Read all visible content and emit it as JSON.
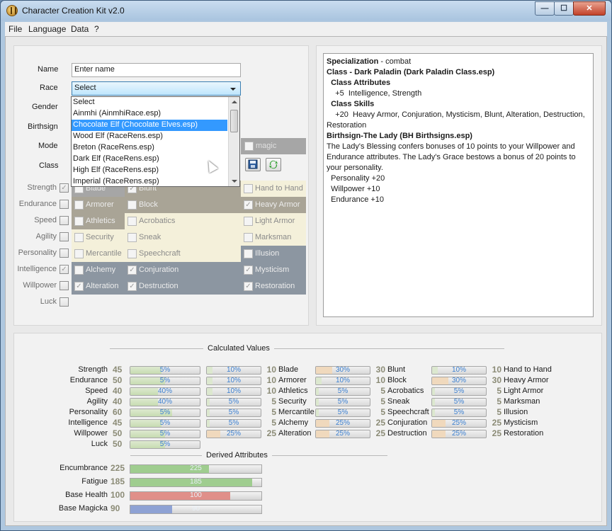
{
  "window": {
    "title": "Character Creation Kit v2.0",
    "min": "—",
    "max": "☐",
    "close": "✕"
  },
  "menu": [
    "File",
    "Language",
    "Data",
    "?"
  ],
  "form": {
    "name_label": "Name",
    "name_value": "Enter name",
    "race_label": "Race",
    "race_value": "Select",
    "gender_label": "Gender",
    "birthsign_label": "Birthsign",
    "mode_label": "Mode",
    "class_label": "Class",
    "magic_label": "magic"
  },
  "race_dropdown": [
    "Select",
    "Ainmhi (AinmhiRace.esp)",
    "Chocolate Elf (Chocolate Elves.esp)",
    "Wood Elf (RaceRens.esp)",
    "Breton (RaceRens.esp)",
    "Dark Elf (RaceRens.esp)",
    "High Elf (RaceRens.esp)",
    "Imperial (RaceRens.esp)"
  ],
  "attributes": [
    {
      "label": "Strength",
      "checked": true
    },
    {
      "label": "Endurance",
      "checked": false
    },
    {
      "label": "Speed",
      "checked": false
    },
    {
      "label": "Agility",
      "checked": false
    },
    {
      "label": "Personality",
      "checked": false
    },
    {
      "label": "Intelligence",
      "checked": true
    },
    {
      "label": "Willpower",
      "checked": false
    },
    {
      "label": "Luck",
      "checked": false
    }
  ],
  "skill_grid": [
    [
      {
        "label": "Blade",
        "checked": false
      },
      {
        "label": "Blunt",
        "checked": true
      },
      {
        "label": "Hand to Hand",
        "checked": false
      }
    ],
    [
      {
        "label": "Armorer",
        "checked": false
      },
      {
        "label": "Block",
        "checked": false
      },
      {
        "label": "Heavy Armor",
        "checked": true
      }
    ],
    [
      {
        "label": "Athletics",
        "checked": false
      },
      {
        "label": "Acrobatics",
        "checked": false
      },
      {
        "label": "Light Armor",
        "checked": false
      }
    ],
    [
      {
        "label": "Security",
        "checked": false
      },
      {
        "label": "Sneak",
        "checked": false
      },
      {
        "label": "Marksman",
        "checked": false
      }
    ],
    [
      {
        "label": "Mercantile",
        "checked": false
      },
      {
        "label": "Speechcraft",
        "checked": false
      },
      {
        "label": "Illusion",
        "checked": false
      }
    ],
    [
      {
        "label": "Alchemy",
        "checked": false
      },
      {
        "label": "Conjuration",
        "checked": true
      },
      {
        "label": "Mysticism",
        "checked": true
      }
    ],
    [
      {
        "label": "Alteration",
        "checked": true
      },
      {
        "label": "Destruction",
        "checked": true
      },
      {
        "label": "Restoration",
        "checked": true
      }
    ]
  ],
  "colors": {
    "gray": "#a6a6a6",
    "tan": "#a9a496",
    "cream": "#f4f0da",
    "slate": "#8c96a1"
  },
  "description": [
    {
      "b": "Specialization",
      "t": " - combat"
    },
    {
      "b": "Class - Dark Paladin (Dark Paladin Class.esp)",
      "t": ""
    },
    {
      "b": "  Class Attributes",
      "t": ""
    },
    {
      "b": "",
      "t": "    +5  Intelligence, Strength"
    },
    {
      "b": "  Class Skills",
      "t": ""
    },
    {
      "b": "",
      "t": "    +20  Heavy Armor, Conjuration, Mysticism, Blunt, Alteration, Destruction,"
    },
    {
      "b": "",
      "t": "Restoration"
    },
    {
      "b": "Birthsign-The Lady (BH Birthsigns.esp)",
      "t": ""
    },
    {
      "b": "",
      "t": "The Lady's Blessing confers bonuses of 10 points to your Willpower and"
    },
    {
      "b": "",
      "t": "Endurance attributes. The Lady's Grace bestows a bonus of 20 points to"
    },
    {
      "b": "",
      "t": "your personality."
    },
    {
      "b": "",
      "t": "  Personality +20"
    },
    {
      "b": "",
      "t": "  Willpower +10"
    },
    {
      "b": "",
      "t": "  Endurance +10"
    }
  ],
  "calc_title": "Calculated Values",
  "derived_title": "Derived Attributes",
  "calc_attributes": [
    {
      "label": "Strength",
      "value": "45",
      "pct": "5%",
      "fill": 0.45
    },
    {
      "label": "Endurance",
      "value": "50",
      "pct": "5%",
      "fill": 0.5
    },
    {
      "label": "Speed",
      "value": "40",
      "pct": "40%",
      "fill": 0.4
    },
    {
      "label": "Agility",
      "value": "40",
      "pct": "40%",
      "fill": 0.4
    },
    {
      "label": "Personality",
      "value": "60",
      "pct": "5%",
      "fill": 0.6
    },
    {
      "label": "Intelligence",
      "value": "45",
      "pct": "5%",
      "fill": 0.45
    },
    {
      "label": "Willpower",
      "value": "50",
      "pct": "5%",
      "fill": 0.5
    },
    {
      "label": "Luck",
      "value": "50",
      "pct": "5%",
      "fill": 0.5
    }
  ],
  "calc_skills": [
    [
      {
        "label": "Blade",
        "value": "10",
        "pct": "10%",
        "fill": 0.1
      },
      {
        "label": "Blunt",
        "value": "30",
        "pct": "30%",
        "fill": 0.3
      },
      {
        "label": "Hand to Hand",
        "value": "10",
        "pct": "10%",
        "fill": 0.1
      }
    ],
    [
      {
        "label": "Armorer",
        "value": "10",
        "pct": "10%",
        "fill": 0.1
      },
      {
        "label": "Block",
        "value": "10",
        "pct": "10%",
        "fill": 0.1
      },
      {
        "label": "Heavy Armor",
        "value": "30",
        "pct": "30%",
        "fill": 0.3
      }
    ],
    [
      {
        "label": "Athletics",
        "value": "10",
        "pct": "10%",
        "fill": 0.1
      },
      {
        "label": "Acrobatics",
        "value": "5",
        "pct": "5%",
        "fill": 0.05
      },
      {
        "label": "Light Armor",
        "value": "5",
        "pct": "5%",
        "fill": 0.05
      }
    ],
    [
      {
        "label": "Security",
        "value": "5",
        "pct": "5%",
        "fill": 0.05
      },
      {
        "label": "Sneak",
        "value": "5",
        "pct": "5%",
        "fill": 0.05
      },
      {
        "label": "Marksman",
        "value": "5",
        "pct": "5%",
        "fill": 0.05
      }
    ],
    [
      {
        "label": "Mercantile",
        "value": "5",
        "pct": "5%",
        "fill": 0.05
      },
      {
        "label": "Speechcraft",
        "value": "5",
        "pct": "5%",
        "fill": 0.05
      },
      {
        "label": "Illusion",
        "value": "5",
        "pct": "5%",
        "fill": 0.05
      }
    ],
    [
      {
        "label": "Alchemy",
        "value": "5",
        "pct": "5%",
        "fill": 0.05
      },
      {
        "label": "Conjuration",
        "value": "25",
        "pct": "25%",
        "fill": 0.25
      },
      {
        "label": "Mysticism",
        "value": "25",
        "pct": "25%",
        "fill": 0.25
      }
    ],
    [
      {
        "label": "Alteration",
        "value": "25",
        "pct": "25%",
        "fill": 0.25
      },
      {
        "label": "Destruction",
        "value": "25",
        "pct": "25%",
        "fill": 0.25
      },
      {
        "label": "Restoration",
        "value": "25",
        "pct": "25%",
        "fill": 0.25
      }
    ]
  ],
  "derived": [
    {
      "label": "Encumbrance",
      "value": "225",
      "bar": "225",
      "fill": 0.6,
      "color": "#9fcd8f"
    },
    {
      "label": "Fatigue",
      "value": "185",
      "bar": "185",
      "fill": 0.93,
      "color": "#9fcd8f"
    },
    {
      "label": "Base Health",
      "value": "100",
      "bar": "100",
      "fill": 0.76,
      "color": "#e08f89"
    },
    {
      "label": "Base Magicka",
      "value": "90",
      "bar": "90",
      "fill": 0.32,
      "color": "#8ea2d4"
    }
  ]
}
